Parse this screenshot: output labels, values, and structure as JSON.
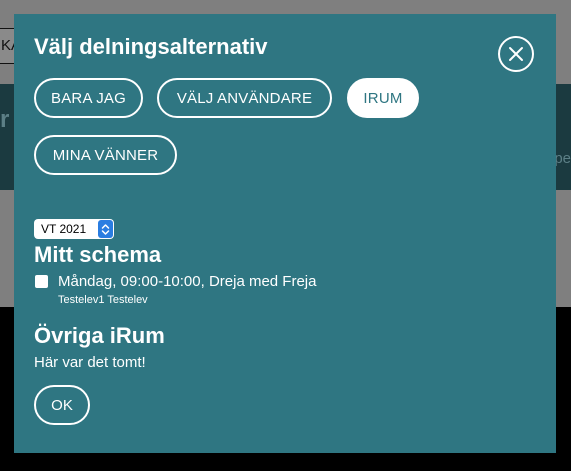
{
  "background": {
    "input_fragment": "KA",
    "band_left_fragment": "r",
    "band_right_fragment": "pe"
  },
  "modal": {
    "title": "Välj delningsalternativ",
    "close_icon": "close-x-icon",
    "options": [
      {
        "label": "BARA JAG",
        "selected": false
      },
      {
        "label": "VÄLJ ANVÄNDARE",
        "selected": false
      },
      {
        "label": "IRUM",
        "selected": true
      },
      {
        "label": "MINA VÄNNER",
        "selected": false
      }
    ],
    "term_select": {
      "value": "VT 2021"
    },
    "my_schedule": {
      "heading": "Mitt schema",
      "items": [
        {
          "label": "Måndag, 09:00-10:00, Dreja med Freja",
          "sub": "Testelev1 Testelev",
          "checked": false
        }
      ]
    },
    "other_rooms": {
      "heading": "Övriga iRum",
      "empty_text": "Här var det tomt!"
    },
    "ok_label": "OK"
  },
  "colors": {
    "modal_bg": "#2f7682",
    "text": "#ffffff",
    "select_arrow_bg": "#2a7de1"
  }
}
